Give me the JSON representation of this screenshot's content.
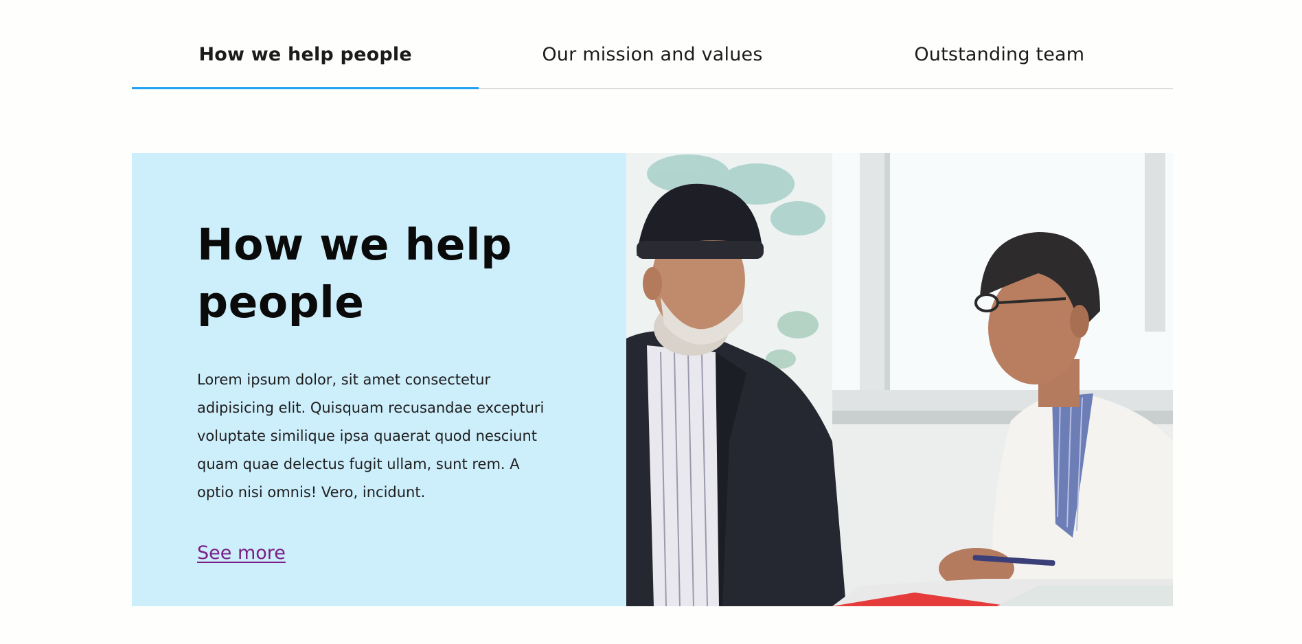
{
  "tabs": [
    {
      "label": "How we help people",
      "active": true
    },
    {
      "label": "Our mission and values",
      "active": false
    },
    {
      "label": "Outstanding team",
      "active": false
    }
  ],
  "feature": {
    "title": "How we help people",
    "body": "Lorem ipsum dolor, sit amet consectetur adipisicing elit. Quisquam recusandae excepturi voluptate similique ipsa quaerat quod nesciunt quam quae delectus fugit ullam, sunt rem. A optio nisi omnis! Vero, incidunt.",
    "link_label": "See more",
    "image_alt": "Elderly man in a dark knit cap talking with a doctor in a white coat"
  },
  "colors": {
    "accent": "#1ea1f2",
    "panel_bg": "#cdeefb",
    "link": "#7a1f86"
  }
}
